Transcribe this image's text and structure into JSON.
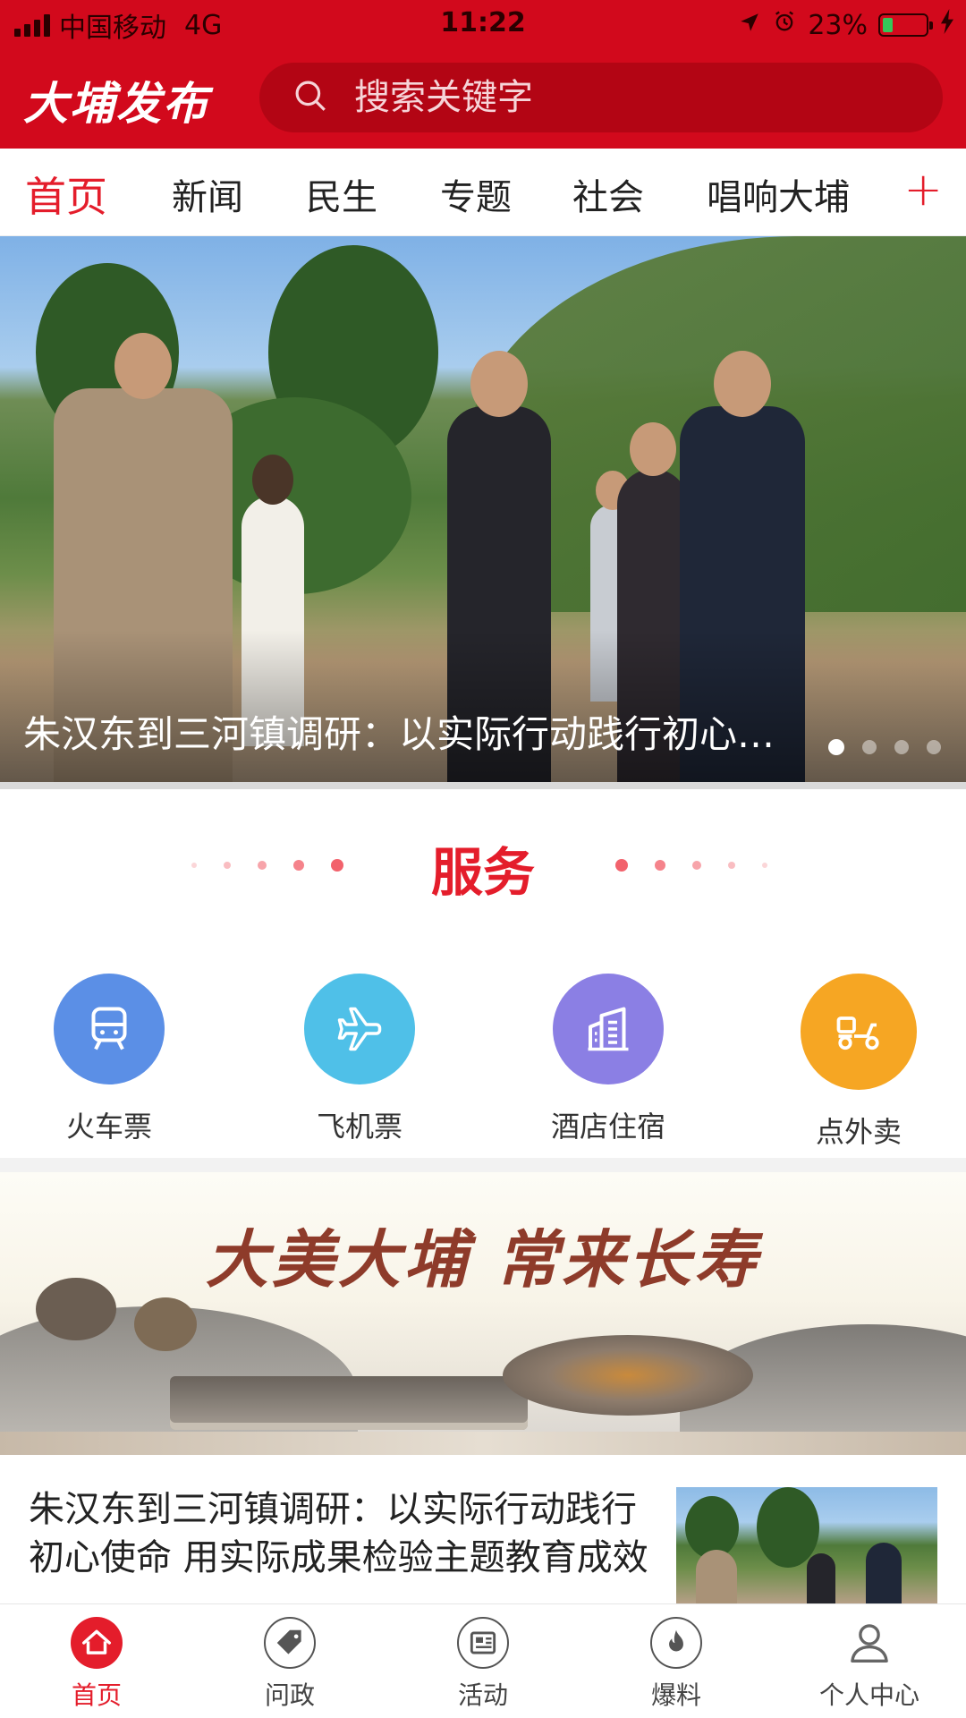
{
  "status_bar": {
    "carrier": "中国移动",
    "network": "4G",
    "time": "11:22",
    "battery_percent": "23%",
    "battery_level": 0.23
  },
  "app": {
    "logo_text": "大埔发布",
    "search_placeholder": "搜索关键字"
  },
  "tabs": [
    {
      "label": "首页",
      "active": true
    },
    {
      "label": "新闻"
    },
    {
      "label": "民生"
    },
    {
      "label": "专题"
    },
    {
      "label": "社会"
    },
    {
      "label": "唱响大埔"
    }
  ],
  "tab_add_label": "+",
  "hero": {
    "caption": "朱汉东到三河镇调研：以实际行动践行初心使命",
    "slide_count": 4,
    "active_slide": 1
  },
  "services": {
    "title": "服务",
    "items": [
      {
        "label": "火车票",
        "icon": "train-icon",
        "color": "#5b8fe6"
      },
      {
        "label": "飞机票",
        "icon": "airplane-icon",
        "color": "#4fc0e8"
      },
      {
        "label": "酒店住宿",
        "icon": "hotel-icon",
        "color": "#8b7fe4"
      },
      {
        "label": "点外卖",
        "icon": "scooter-icon",
        "color": "#f6a623"
      }
    ]
  },
  "promo": {
    "text": "大美大埔 常来长寿"
  },
  "news": [
    {
      "title": "朱汉东到三河镇调研：以实际行动践行初心使命 用实际成果检验主题教育成效"
    }
  ],
  "bottom_nav": [
    {
      "label": "首页",
      "icon": "home-icon",
      "active": true
    },
    {
      "label": "问政",
      "icon": "tag-icon"
    },
    {
      "label": "活动",
      "icon": "newspaper-icon"
    },
    {
      "label": "爆料",
      "icon": "flame-icon"
    },
    {
      "label": "个人中心",
      "icon": "user-icon"
    }
  ],
  "colors": {
    "brand_red": "#d2091c",
    "accent_red": "#e41d2b"
  }
}
